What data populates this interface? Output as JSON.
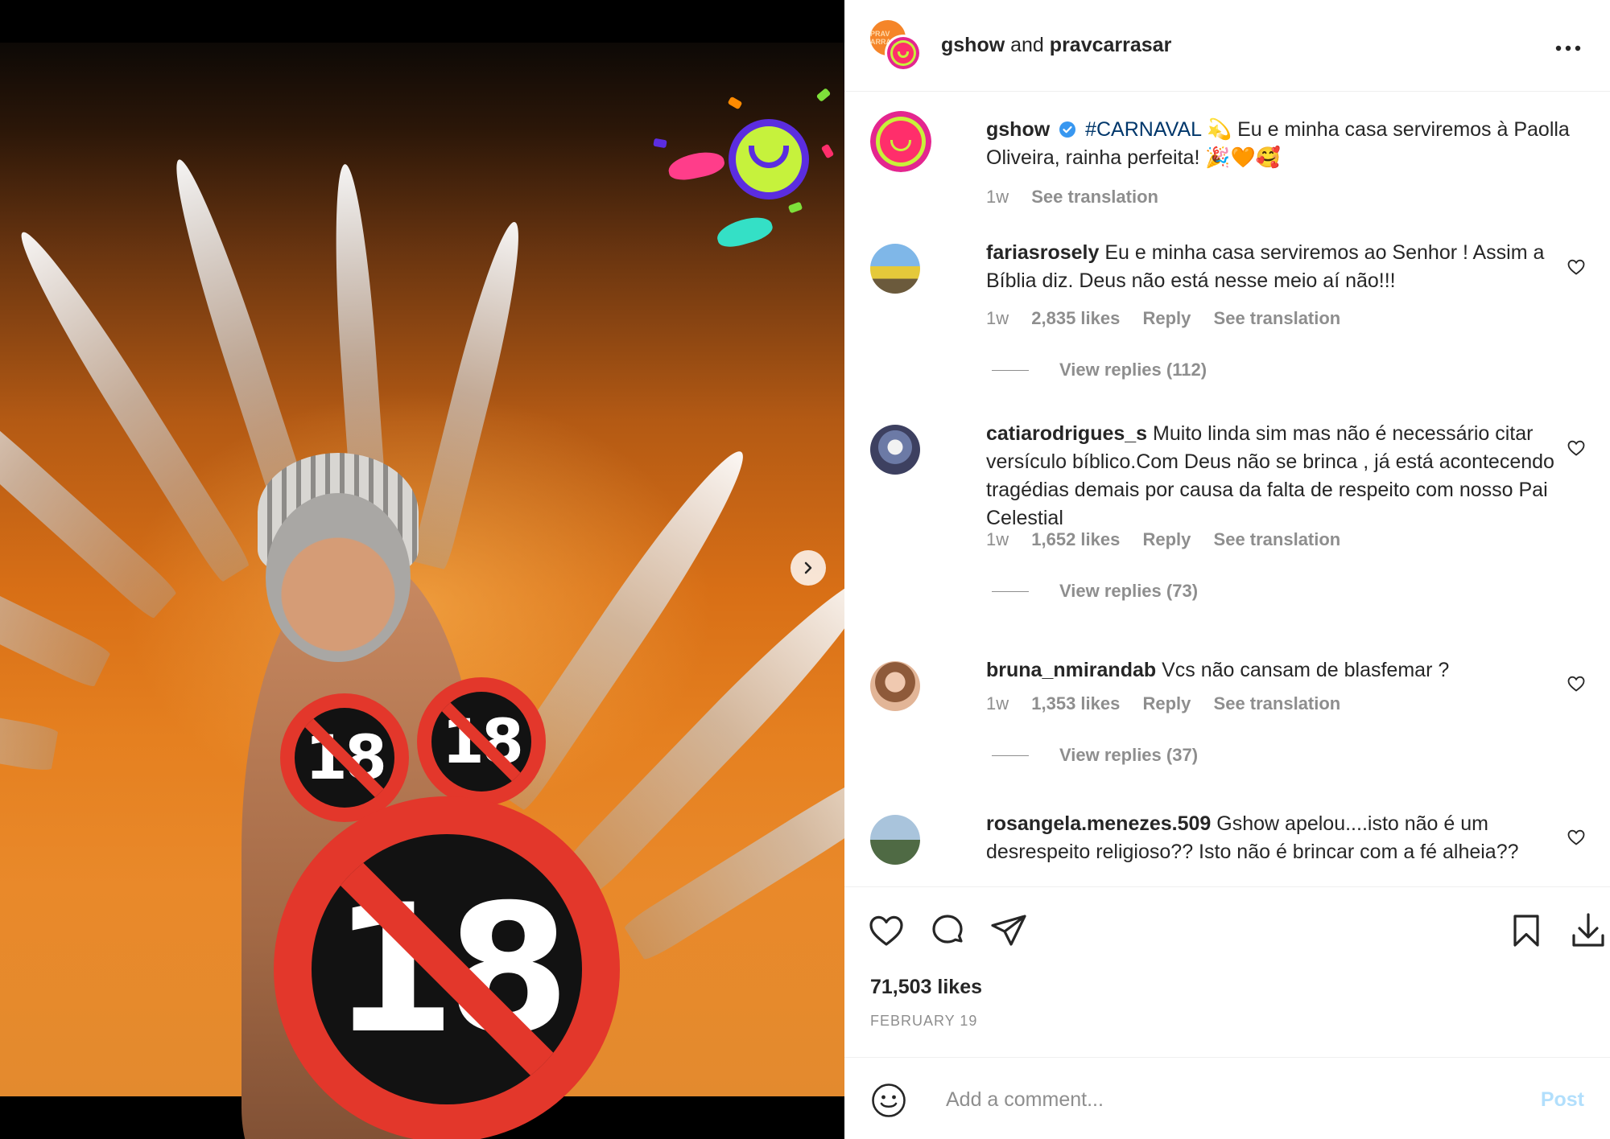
{
  "header": {
    "account1": "gshow",
    "joiner": "and",
    "account2": "pravcarrasar",
    "collab_avatar_text": "PRAV ARRA",
    "more_icon": "more-horizontal-icon"
  },
  "media": {
    "sticker_text": "18",
    "next_icon": "chevron-right-icon"
  },
  "caption": {
    "user": "gshow",
    "verified_icon": "verified-badge-icon",
    "hashtag": "#CARNAVAL",
    "text": "💫 Eu e minha casa serviremos à Paolla Oliveira, rainha perfeita! 🎉🧡🥰",
    "time": "1w",
    "see_translation": "See translation"
  },
  "comments": [
    {
      "user": "fariasrosely",
      "text": "Eu e minha casa serviremos ao Senhor ! Assim a Bíblia diz. Deus não está nesse meio aí não!!!",
      "time": "1w",
      "likes": "2,835 likes",
      "reply": "Reply",
      "see_translation": "See translation",
      "view_replies": "View replies (112)"
    },
    {
      "user": "catiarodrigues_s",
      "text": "Muito linda sim mas não é necessário citar versículo bíblico.Com Deus não se brinca , já está acontecendo tragédias demais por causa da falta de respeito com nosso Pai Celestial",
      "time": "1w",
      "likes": "1,652 likes",
      "reply": "Reply",
      "see_translation": "See translation",
      "view_replies": "View replies (73)"
    },
    {
      "user": "bruna_nmirandab",
      "text": "Vcs não cansam de blasfemar ?",
      "time": "1w",
      "likes": "1,353 likes",
      "reply": "Reply",
      "see_translation": "See translation",
      "view_replies": "View replies (37)"
    },
    {
      "user": "rosangela.menezes.509",
      "text": "Gshow apelou....isto não é um desrespeito religioso?? Isto não é brincar com a fé alheia??"
    }
  ],
  "actions": {
    "likes": "71,503 likes",
    "date": "FEBRUARY 19",
    "like_icon": "heart-icon",
    "comment_icon": "comment-icon",
    "share_icon": "send-icon",
    "save_icon": "bookmark-icon",
    "download_icon": "download-icon"
  },
  "comment_box": {
    "placeholder": "Add a comment...",
    "post_label": "Post",
    "emoji_icon": "emoji-icon"
  },
  "colors": {
    "link": "#00376b",
    "muted": "#8e8e8e",
    "post_disabled": "#b2dffc",
    "verified": "#3897f0"
  }
}
